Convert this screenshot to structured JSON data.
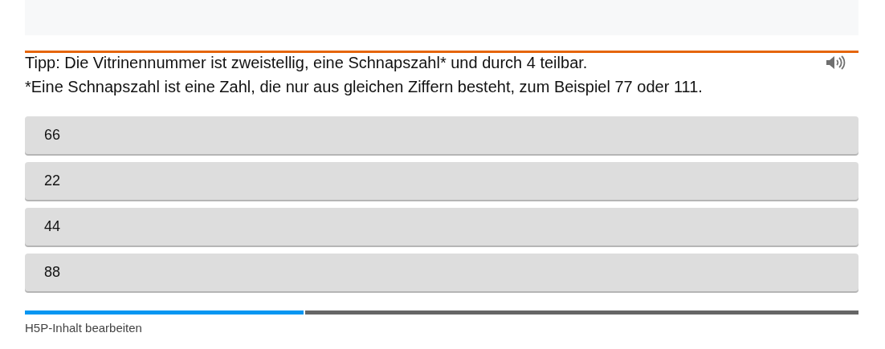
{
  "hint": {
    "lines": [
      "Tipp: Die Vitrinennummer ist zweistellig, eine Schnapszahl* und durch 4 teilbar.",
      "*Eine Schnapszahl ist eine Zahl, die nur aus gleichen Ziffern besteht, zum Beispiel 77 oder 111."
    ]
  },
  "answers": [
    "66",
    "22",
    "44",
    "88"
  ],
  "progress": {
    "level": 0.334
  },
  "footer_link": "H5P-Inhalt bearbeiten"
}
